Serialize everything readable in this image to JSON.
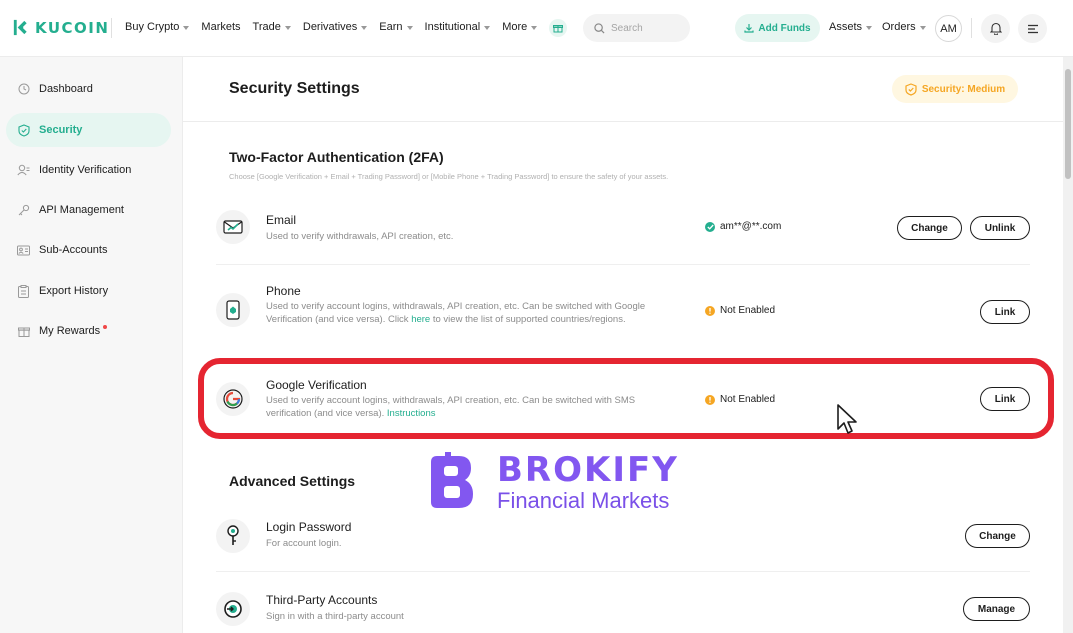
{
  "brand": {
    "name": "KUCOIN",
    "accent": "#24ae8f"
  },
  "topnav": {
    "items": [
      {
        "label": "Buy Crypto",
        "dropdown": true
      },
      {
        "label": "Markets",
        "dropdown": false
      },
      {
        "label": "Trade",
        "dropdown": true
      },
      {
        "label": "Derivatives",
        "dropdown": true
      },
      {
        "label": "Earn",
        "dropdown": true
      },
      {
        "label": "Institutional",
        "dropdown": true
      },
      {
        "label": "More",
        "dropdown": true
      }
    ],
    "search_placeholder": "Search",
    "add_funds": "Add Funds",
    "assets": "Assets",
    "orders": "Orders",
    "avatar_initials": "AM"
  },
  "sidebar": {
    "items": [
      {
        "label": "Dashboard",
        "icon": "clock-icon",
        "active": false
      },
      {
        "label": "Security",
        "icon": "shield-icon",
        "active": true
      },
      {
        "label": "Identity Verification",
        "icon": "user-icon",
        "active": false
      },
      {
        "label": "API Management",
        "icon": "key-icon",
        "active": false
      },
      {
        "label": "Sub-Accounts",
        "icon": "sub-accounts-icon",
        "active": false
      },
      {
        "label": "Export History",
        "icon": "clipboard-icon",
        "active": false
      },
      {
        "label": "My Rewards",
        "icon": "gift-icon",
        "active": false,
        "badge_dot": true
      }
    ]
  },
  "main": {
    "title": "Security Settings",
    "security_level": "Security: Medium",
    "twofa": {
      "title": "Two-Factor Authentication (2FA)",
      "description": "Choose [Google Verification + Email + Trading Password] or [Mobile Phone + Trading Password] to ensure the safety of your assets.",
      "rows": {
        "email": {
          "title": "Email",
          "desc": "Used to verify withdrawals, API creation, etc.",
          "status": "am**@**.com",
          "btn_change": "Change",
          "btn_unlink": "Unlink"
        },
        "phone": {
          "title": "Phone",
          "desc_before": "Used to verify account logins, withdrawals, API creation, etc. Can be switched with Google Verification (and vice versa). Click ",
          "desc_link": "here",
          "desc_after": " to view the list of supported countries/regions.",
          "status": "Not Enabled",
          "btn_link": "Link"
        },
        "google": {
          "title": "Google Verification",
          "desc_before": "Used to verify account logins, withdrawals, API creation, etc. Can be switched with SMS verification (and vice versa). ",
          "desc_link": "Instructions",
          "status": "Not Enabled",
          "btn_link": "Link"
        }
      }
    },
    "advanced": {
      "title": "Advanced Settings",
      "rows": {
        "login_password": {
          "title": "Login Password",
          "desc": "For account login.",
          "btn": "Change"
        },
        "third_party": {
          "title": "Third-Party Accounts",
          "desc": "Sign in with a third-party account",
          "btn": "Manage"
        }
      }
    }
  },
  "watermark": {
    "line1": "BROKIFY",
    "line2": "Financial Markets",
    "color": "#8257f0"
  },
  "colors": {
    "warning": "#f5a623",
    "highlight": "#e52531",
    "success": "#24ae8f"
  }
}
